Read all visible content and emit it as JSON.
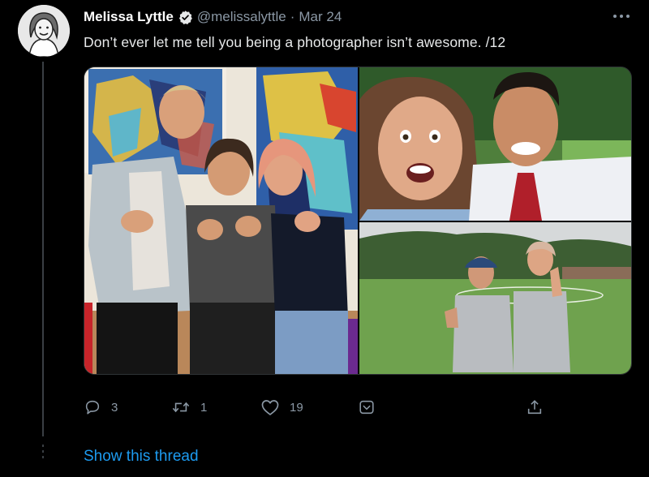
{
  "author": {
    "display_name": "Melissa Lyttle",
    "handle": "@melissalyttle",
    "separator": "·",
    "date": "Mar 24",
    "verified": true
  },
  "tweet": {
    "text": "Don’t ever let me tell you being a photographer isn’t awesome.  /12"
  },
  "media": {
    "photos": [
      {
        "name": "photo-three-people-thumbs-up"
      },
      {
        "name": "photo-selfie-two-people"
      },
      {
        "name": "photo-two-people-on-field"
      }
    ]
  },
  "actions": {
    "reply_count": "3",
    "retweet_count": "1",
    "like_count": "19"
  },
  "thread": {
    "show_label": "Show this thread"
  },
  "colors": {
    "background": "#000000",
    "text": "#e7e9ea",
    "muted": "#8b98a5",
    "accent": "#1d9bf0"
  },
  "icons": [
    "verified-badge-icon",
    "more-icon",
    "reply-icon",
    "retweet-icon",
    "like-icon",
    "share-dm-icon",
    "share-icon"
  ]
}
